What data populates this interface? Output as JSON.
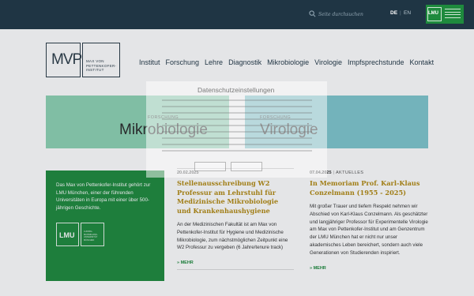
{
  "topbar": {
    "search_placeholder": "Seite durchsuchen",
    "lang_de": "DE",
    "lang_separator": "|",
    "lang_en": "EN",
    "lmu_label": "LMU",
    "bg_color": "#1f3544"
  },
  "header": {
    "logo_mark": "MVP",
    "logo_text_lines": [
      "MAX VON",
      "PETTENKOFER-",
      "INSTITUT"
    ],
    "nav": [
      "Institut",
      "Forschung",
      "Lehre",
      "Diagnostik",
      "Mikrobiologie",
      "Virologie",
      "Impfsprechstunde",
      "Kontakt"
    ]
  },
  "tiles": [
    {
      "kicker": "FORSCHUNG",
      "title": "Mikrobiologie",
      "color": "#8ed3b3"
    },
    {
      "kicker": "FORSCHUNG",
      "title": "Virologie",
      "color": "#7fc7cd"
    }
  ],
  "infobox": {
    "text": "Das Max von Pettenkofer-Institut gehört zur LMU München, einer der führenden Universitäten in Europa mit einer über 500-jährigen Geschichte.",
    "badge_label": "LMU",
    "badge_small": "LUDWIG-MAXIMILIANS-UNIVERSITÄT MÜNCHEN",
    "color": "#1e8a3d"
  },
  "news": [
    {
      "date": "20.02.2025",
      "category": "",
      "headline": "Stellenausschreibung W2 Professur am Lehrstuhl für Medizinische Mikrobiologie und Krankenhaushygiene",
      "body": "An der Medizinischen Fakultät ist am Max von Pettenkofer-Institut für Hygiene und Medizinische Mikrobiologie, zum nächstmöglichen Zeitpunkt eine W2 Professur zu vergeben (6 Jahre/tenure track)",
      "more": "» MEHR"
    },
    {
      "date": "07.04.2025",
      "category": "AKTUELLES",
      "headline": "In Memoriam Prof. Karl-Klaus Conzelmann (1955 - 2025)",
      "body": "Mit großer Trauer und tiefem Respekt nehmen wir Abschied von Karl-Klaus Conzelmann. Als geschätzter und langjähriger Professor für Experimentelle Virologie am Max von Pettenkofer-Institut und am Genzentrum der LMU München hat er nicht nur unser akademisches Leben bereichert, sondern auch viele Generationen von Studierenden inspiriert.",
      "more": "» MEHR"
    }
  ],
  "consent": {
    "title": "Datenschutzeinstellungen"
  },
  "colors": {
    "accent_gold": "#b38a12",
    "lmu_green": "#1e8a3d"
  }
}
